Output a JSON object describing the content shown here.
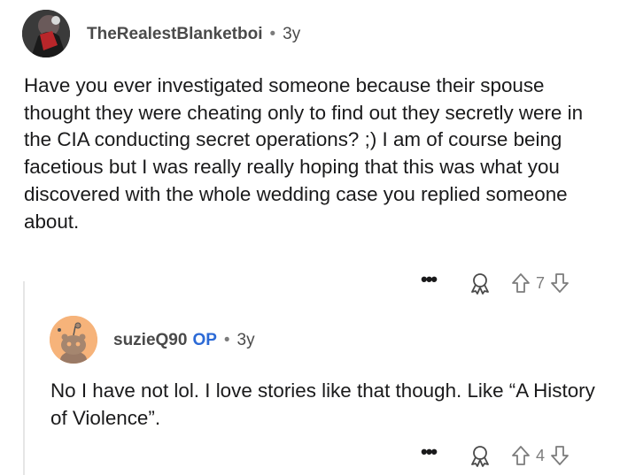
{
  "comments": [
    {
      "username": "TheRealestBlanketboi",
      "age": "3y",
      "separator": "•",
      "body": "Have you ever investigated someone because their spouse thought they were cheating only to find out they secretly were in the CIA conducting secret operations? ;) I am of course being facetious but I was really really hoping that this was what you discovered with the whole wedding case you replied someone about.",
      "more_label": "•••",
      "vote_count": "7"
    },
    {
      "username": "suzieQ90",
      "op_badge": "OP",
      "age": "3y",
      "separator": "•",
      "body": "No I have not lol. I love stories like that though. Like “A History of Violence”.",
      "more_label": "•••",
      "vote_count": "4"
    }
  ],
  "colors": {
    "op_badge": "#2c6ad6",
    "meta_text": "#4a4a4a",
    "body_text": "#1a1a1b",
    "icon_stroke": "#7c7c7c",
    "avatar2_bg": "#f6b37a"
  },
  "icons": [
    "avatar",
    "more-options-icon",
    "award-icon",
    "upvote-icon",
    "downvote-icon"
  ]
}
